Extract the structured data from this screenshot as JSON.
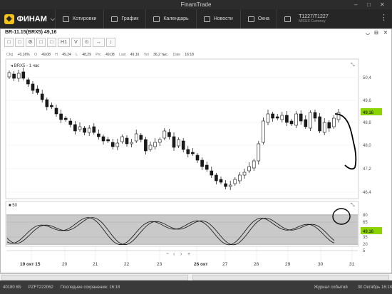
{
  "window": {
    "title": "FinamTrade",
    "controls": [
      "–",
      "□",
      "✕"
    ]
  },
  "menu": {
    "logo": "ФИНАМ",
    "items": [
      {
        "label": "Котировки",
        "icon": "quotes-icon"
      },
      {
        "label": "График",
        "icon": "chart-icon"
      },
      {
        "label": "Календарь",
        "icon": "calendar-icon"
      },
      {
        "label": "Новости",
        "icon": "news-icon"
      },
      {
        "label": "Окна",
        "icon": "windows-icon"
      }
    ],
    "account": {
      "name": "T1227/T1227",
      "sub": "MICEX Currency"
    }
  },
  "panel": {
    "title": "BR-11.15(BRX5) 49,16",
    "controls": [
      "◡",
      "⊟",
      "✕"
    ]
  },
  "toolbar": [
    "□",
    "□",
    "⚙",
    "□",
    "□",
    "H1",
    "V",
    "⊙",
    "↔",
    "↕"
  ],
  "info": {
    "chg_label": "Chg",
    "chg": "+0,16%",
    "o_label": "O",
    "o": "49,08",
    "h_label": "H",
    "h": "49,24",
    "l_label": "L",
    "l": "48,29",
    "prc_label": "Prc",
    "prc": "49,08",
    "last_label": "Last",
    "last": "49,16",
    "vol_label": "Vol",
    "vol": "36,2 тыс.",
    "date_label": "Date",
    "date": "16:18"
  },
  "price_label": "BRX5 - 1 час",
  "price_axis": [
    "50,4",
    "49,6",
    "48,8",
    "48,0",
    "47,2",
    "46,4"
  ],
  "last_tag": "49,16",
  "osc_label": "50",
  "osc_axis": [
    "80",
    "65",
    "35",
    "20",
    "5"
  ],
  "osc_tag": "49,16",
  "time_axis": [
    "19 окт 15",
    "20",
    "21",
    "22",
    "23",
    "26 окт",
    "27",
    "28",
    "29",
    "30",
    "31"
  ],
  "chart_controls": [
    "−",
    "‹",
    "›",
    "+"
  ],
  "status": {
    "balance": "40180 КБ",
    "account": "PZFT222062",
    "save": "Последнее сохранение: 16:18",
    "journal": "Журнал событий",
    "datetime": "30 Октябрь 16:18"
  },
  "colors": {
    "up": "#ffffff",
    "down": "#1a1a1a",
    "tag": "#8bd400",
    "band": "#c9c9c9"
  }
}
